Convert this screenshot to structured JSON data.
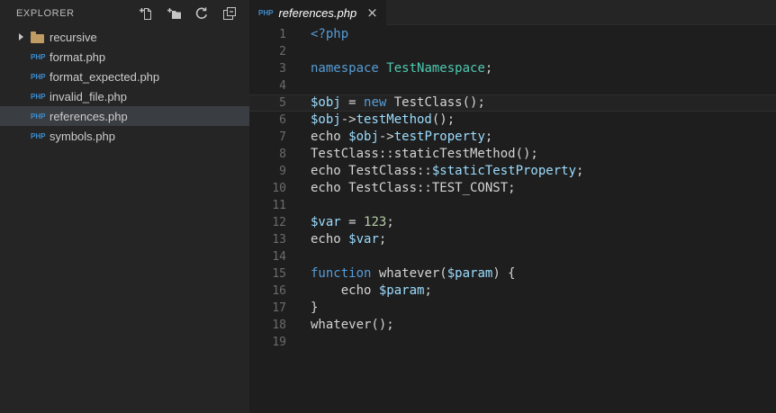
{
  "colors": {
    "editor_bg": "#1e1e1e",
    "sidebar_bg": "#252526",
    "tabbar_bg": "#252526",
    "selected_row_bg": "#3a3d41",
    "current_line_border": "#2e2e2e",
    "keyword": "#569cd6",
    "class_name": "#4ec9b0",
    "variable": "#9cdcfe",
    "number": "#b5cea8",
    "plain_text": "#d4d4d4",
    "line_number": "#6b6b6b",
    "php_icon_blue": "#3e8ed0",
    "folder_icon_tan": "#c09b62",
    "icon_gray": "#c5c5c5"
  },
  "icons": {
    "php_label": "PHP",
    "close": "×"
  },
  "sidebar": {
    "title": "EXPLORER",
    "actions": [
      {
        "name": "new-file",
        "label": "New File"
      },
      {
        "name": "new-folder",
        "label": "New Folder"
      },
      {
        "name": "refresh",
        "label": "Refresh"
      },
      {
        "name": "collapse-all",
        "label": "Collapse All"
      }
    ],
    "files": [
      {
        "label": "recursive",
        "kind": "folder",
        "expanded": false,
        "selected": false
      },
      {
        "label": "format.php",
        "kind": "php-file",
        "selected": false
      },
      {
        "label": "format_expected.php",
        "kind": "php-file",
        "selected": false
      },
      {
        "label": "invalid_file.php",
        "kind": "php-file",
        "selected": false
      },
      {
        "label": "references.php",
        "kind": "php-file",
        "selected": true
      },
      {
        "label": "symbols.php",
        "kind": "php-file",
        "selected": false
      }
    ]
  },
  "editor": {
    "tabs": [
      {
        "title": "references.php",
        "icon": "php",
        "active": true,
        "preview": true
      }
    ],
    "lines": [
      {
        "n": 1,
        "current": false,
        "tokens": [
          [
            "<?php",
            "kw"
          ]
        ]
      },
      {
        "n": 2,
        "current": false,
        "tokens": []
      },
      {
        "n": 3,
        "current": false,
        "tokens": [
          [
            "namespace",
            "kw"
          ],
          [
            " ",
            "pln"
          ],
          [
            "TestNamespace",
            "cls"
          ],
          [
            ";",
            "pln"
          ]
        ]
      },
      {
        "n": 4,
        "current": false,
        "tokens": []
      },
      {
        "n": 5,
        "current": true,
        "tokens": [
          [
            "$obj",
            "var"
          ],
          [
            " = ",
            "pln"
          ],
          [
            "new",
            "kw"
          ],
          [
            " TestClass();",
            "pln"
          ]
        ]
      },
      {
        "n": 6,
        "current": false,
        "tokens": [
          [
            "$obj",
            "var"
          ],
          [
            "->",
            "pln"
          ],
          [
            "testMethod",
            "var"
          ],
          [
            "();",
            "pln"
          ]
        ]
      },
      {
        "n": 7,
        "current": false,
        "tokens": [
          [
            "echo ",
            "pln"
          ],
          [
            "$obj",
            "var"
          ],
          [
            "->",
            "pln"
          ],
          [
            "testProperty",
            "var"
          ],
          [
            ";",
            "pln"
          ]
        ]
      },
      {
        "n": 8,
        "current": false,
        "tokens": [
          [
            "TestClass::staticTestMethod();",
            "pln"
          ]
        ]
      },
      {
        "n": 9,
        "current": false,
        "tokens": [
          [
            "echo TestClass::",
            "pln"
          ],
          [
            "$staticTestProperty",
            "var"
          ],
          [
            ";",
            "pln"
          ]
        ]
      },
      {
        "n": 10,
        "current": false,
        "tokens": [
          [
            "echo TestClass::TEST_CONST;",
            "pln"
          ]
        ]
      },
      {
        "n": 11,
        "current": false,
        "tokens": []
      },
      {
        "n": 12,
        "current": false,
        "tokens": [
          [
            "$var",
            "var"
          ],
          [
            " = ",
            "pln"
          ],
          [
            "123",
            "num"
          ],
          [
            ";",
            "pln"
          ]
        ]
      },
      {
        "n": 13,
        "current": false,
        "tokens": [
          [
            "echo ",
            "pln"
          ],
          [
            "$var",
            "var"
          ],
          [
            ";",
            "pln"
          ]
        ]
      },
      {
        "n": 14,
        "current": false,
        "tokens": []
      },
      {
        "n": 15,
        "current": false,
        "tokens": [
          [
            "function",
            "kw"
          ],
          [
            " whatever(",
            "pln"
          ],
          [
            "$param",
            "var"
          ],
          [
            ") {",
            "pln"
          ]
        ]
      },
      {
        "n": 16,
        "current": false,
        "tokens": [
          [
            "    echo ",
            "pln"
          ],
          [
            "$param",
            "var"
          ],
          [
            ";",
            "pln"
          ]
        ]
      },
      {
        "n": 17,
        "current": false,
        "tokens": [
          [
            "}",
            "pln"
          ]
        ]
      },
      {
        "n": 18,
        "current": false,
        "tokens": [
          [
            "whatever();",
            "pln"
          ]
        ]
      },
      {
        "n": 19,
        "current": false,
        "tokens": []
      }
    ]
  }
}
